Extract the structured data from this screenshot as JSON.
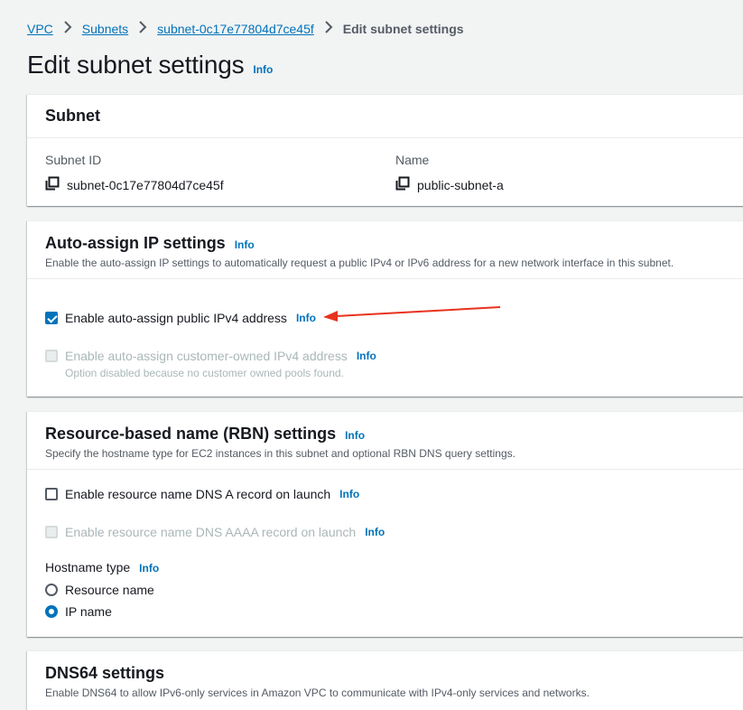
{
  "breadcrumb": {
    "items": [
      "VPC",
      "Subnets",
      "subnet-0c17e77804d7ce45f"
    ],
    "current": "Edit subnet settings"
  },
  "page": {
    "title": "Edit subnet settings",
    "info": "Info"
  },
  "subnet_panel": {
    "title": "Subnet",
    "subnet_id_label": "Subnet ID",
    "subnet_id_value": "subnet-0c17e77804d7ce45f",
    "name_label": "Name",
    "name_value": "public-subnet-a",
    "copy_icon": "copy-icon"
  },
  "auto_assign": {
    "title": "Auto-assign IP settings",
    "info": "Info",
    "description": "Enable the auto-assign IP settings to automatically request a public IPv4 or IPv6 address for a new network interface in this subnet.",
    "ipv4_label": "Enable auto-assign public IPv4 address",
    "ipv4_checked": true,
    "ipv4_info": "Info",
    "customer_owned_label": "Enable auto-assign customer-owned IPv4 address",
    "customer_owned_checked": false,
    "customer_owned_disabled": true,
    "customer_owned_info": "Info",
    "customer_owned_note": "Option disabled because no customer owned pools found."
  },
  "rbn": {
    "title": "Resource-based name (RBN) settings",
    "info": "Info",
    "description": "Specify the hostname type for EC2 instances in this subnet and optional RBN DNS query settings.",
    "dns_a_label": "Enable resource name DNS A record on launch",
    "dns_a_checked": false,
    "dns_a_info": "Info",
    "dns_aaaa_label": "Enable resource name DNS AAAA record on launch",
    "dns_aaaa_disabled": true,
    "dns_aaaa_info": "Info",
    "hostname_type_label": "Hostname type",
    "hostname_type_info": "Info",
    "options": [
      "Resource name",
      "IP name"
    ],
    "selected_option": "IP name"
  },
  "dns64": {
    "title": "DNS64 settings",
    "description": "Enable DNS64 to allow IPv6-only services in Amazon VPC to communicate with IPv4-only services and networks."
  },
  "colors": {
    "link": "#0073bb",
    "annotation_arrow": "#e8321e",
    "background": "#f2f3f3"
  }
}
